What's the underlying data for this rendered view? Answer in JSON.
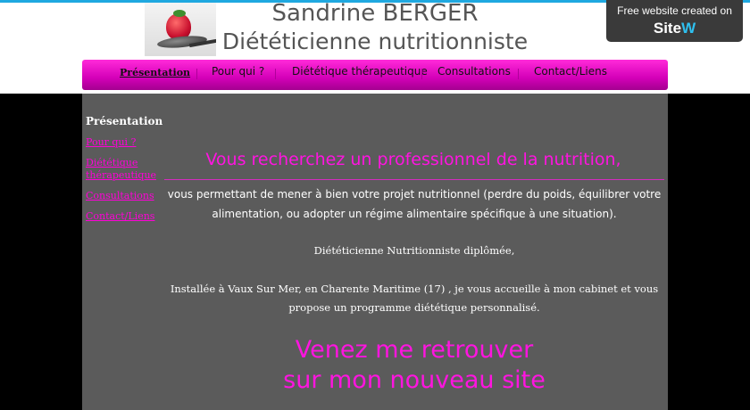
{
  "header": {
    "title": "Sandrine BERGER",
    "subtitle": "Diététicienne nutritionniste",
    "logo_alt": "strawberry-on-spoon"
  },
  "badge": {
    "line1": "Free website created on",
    "brand_prefix": "Site",
    "brand_suffix": "W"
  },
  "nav": {
    "items": [
      {
        "label": "Présentation",
        "active": true
      },
      {
        "label": "Pour qui ?"
      },
      {
        "label": "Diététique thérapeutique"
      },
      {
        "label": "Consultations"
      },
      {
        "label": "Contact/Liens"
      }
    ]
  },
  "sidebar": {
    "title": "Présentation",
    "links": [
      "Pour qui ?",
      "Diététique thérapeutique",
      "Consultations",
      "Contact/Liens"
    ]
  },
  "main": {
    "headline": "Vous recherchez un professionnel de la nutrition,",
    "para1": "vous permettant de mener à bien votre projet nutritionnel (perdre du poids, équilibrer votre alimentation, ou adopter un régime alimentaire spécifique à une situation).",
    "para2": "Diététicienne Nutritionniste diplômée,",
    "para3": "Installée à Vaux Sur Mer,  en Charente Maritime (17) , je vous accueille à mon cabinet et vous propose un programme diététique personnalisé.",
    "cta_line1": "Venez me retrouver",
    "cta_line2": "sur mon nouveau site"
  },
  "colors": {
    "accent": "#ff14e0",
    "nav": "#d400b8",
    "content_bg": "#5b5b5b",
    "badge_bg": "#3a3a3a",
    "brand_w": "#2ec0ef"
  }
}
